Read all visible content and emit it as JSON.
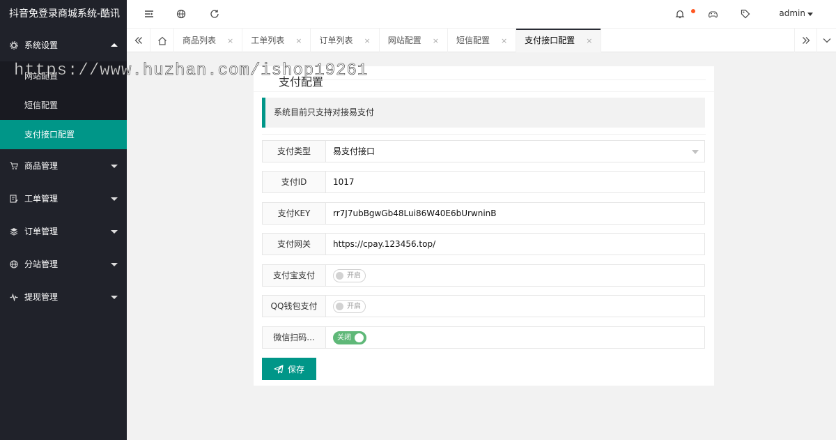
{
  "app": {
    "title": "抖音免登录商城系统-酷讯"
  },
  "sidebar": {
    "groups": [
      {
        "label": "系统设置",
        "icon": "gear-icon",
        "expanded": true,
        "children": [
          {
            "label": "网站配置",
            "active": false
          },
          {
            "label": "短信配置",
            "active": false
          },
          {
            "label": "支付接口配置",
            "active": true
          }
        ]
      },
      {
        "label": "商品管理",
        "icon": "cart-icon"
      },
      {
        "label": "工单管理",
        "icon": "ticket-icon"
      },
      {
        "label": "订单管理",
        "icon": "layers-icon"
      },
      {
        "label": "分站管理",
        "icon": "globe-icon"
      },
      {
        "label": "提现管理",
        "icon": "pulse-icon"
      }
    ]
  },
  "header": {
    "user": "admin"
  },
  "tabs": [
    {
      "label": "商品列表"
    },
    {
      "label": "工单列表"
    },
    {
      "label": "订单列表"
    },
    {
      "label": "网站配置"
    },
    {
      "label": "短信配置"
    },
    {
      "label": "支付接口配置",
      "active": true
    }
  ],
  "tab_close": "×",
  "page": {
    "title": "支付配置",
    "notice": "系统目前只支持对接易支付",
    "fields": {
      "type": {
        "label": "支付类型",
        "value": "易支付接口"
      },
      "id": {
        "label": "支付ID",
        "value": "1017"
      },
      "key": {
        "label": "支付KEY",
        "value": "rr7J7ubBgwGb48Lui86W40E6bUrwninB"
      },
      "gateway": {
        "label": "支付网关",
        "value": "https://cpay.123456.top/"
      },
      "alipay": {
        "label": "支付宝支付",
        "switch_text": "开启",
        "on": false
      },
      "qq": {
        "label": "QQ钱包支付",
        "switch_text": "开启",
        "on": false
      },
      "wechat": {
        "label": "微信扫码...",
        "switch_text": "关闭",
        "on": true
      }
    },
    "save_label": "保存"
  },
  "watermark": "https://www.huzhan.com/ishop19261",
  "colors": {
    "accent": "#009688",
    "sidebar": "#20222a",
    "switch_on": "#5fb878",
    "badge": "#ff5722"
  }
}
